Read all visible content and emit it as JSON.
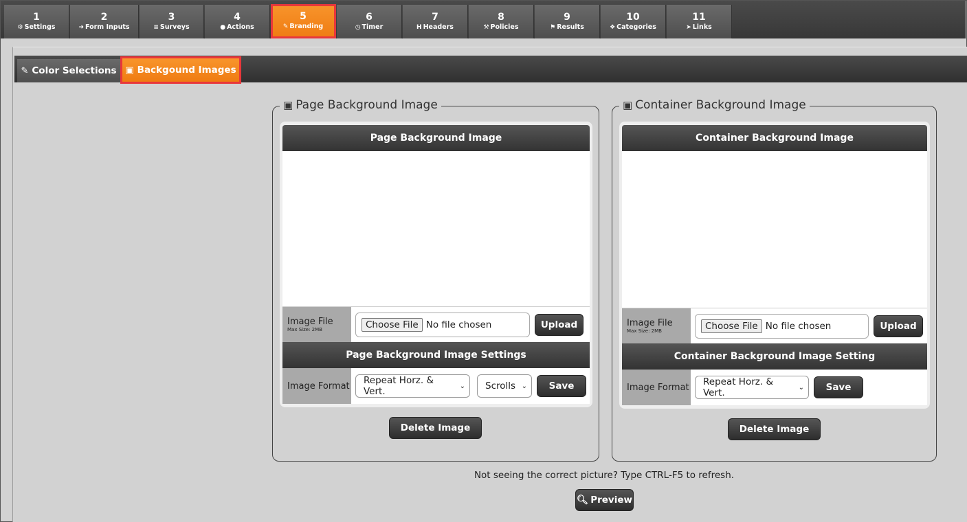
{
  "steps": [
    {
      "num": "1",
      "label": "Settings",
      "icon": "gear-icon",
      "glyph": "⚙"
    },
    {
      "num": "2",
      "label": "Form Inputs",
      "icon": "sign-in-icon",
      "glyph": "➜"
    },
    {
      "num": "3",
      "label": "Surveys",
      "icon": "list-icon",
      "glyph": "≡"
    },
    {
      "num": "4",
      "label": "Actions",
      "icon": "user-icon",
      "glyph": "●"
    },
    {
      "num": "5",
      "label": "Branding",
      "icon": "paintbrush-icon",
      "glyph": "✎"
    },
    {
      "num": "6",
      "label": "Timer",
      "icon": "clock-icon",
      "glyph": "◷"
    },
    {
      "num": "7",
      "label": "Headers",
      "icon": "header-icon",
      "glyph": "H"
    },
    {
      "num": "8",
      "label": "Policies",
      "icon": "gavel-icon",
      "glyph": "⚒"
    },
    {
      "num": "9",
      "label": "Results",
      "icon": "flag-icon",
      "glyph": "⚑"
    },
    {
      "num": "10",
      "label": "Categories",
      "icon": "cubes-icon",
      "glyph": "❖"
    },
    {
      "num": "11",
      "label": "Links",
      "icon": "pointer-icon",
      "glyph": "➤"
    }
  ],
  "subtabs": {
    "color_selections": "Color Selections",
    "background_images": "Backgound Images"
  },
  "page_panel": {
    "legend": "Page Background Image",
    "header": "Page Background Image",
    "image_file_label": "Image File",
    "max_size": "Max Size: 2MB",
    "choose_file": "Choose File",
    "no_file": "No file chosen",
    "upload": "Upload",
    "settings_header": "Page Background Image Settings",
    "image_format_label": "Image Format",
    "format_value": "Repeat Horz. & Vert.",
    "scroll_value": "Scrolls",
    "save": "Save",
    "delete": "Delete Image"
  },
  "container_panel": {
    "legend": "Container Background Image",
    "header": "Container Background Image",
    "image_file_label": "Image File",
    "max_size": "Max Size: 2MB",
    "choose_file": "Choose File",
    "no_file": "No file chosen",
    "upload": "Upload",
    "settings_header": "Container Background Image Setting",
    "image_format_label": "Image Format",
    "format_value": "Repeat Horz. & Vert.",
    "save": "Save",
    "delete": "Delete Image"
  },
  "refresh_note": "Not seeing the correct picture? Type CTRL-F5 to refresh.",
  "preview_button": "Preview",
  "colors": {
    "accent": "#f28a1f",
    "active_outline": "#e8373b",
    "dark": "#3a3a3a"
  }
}
